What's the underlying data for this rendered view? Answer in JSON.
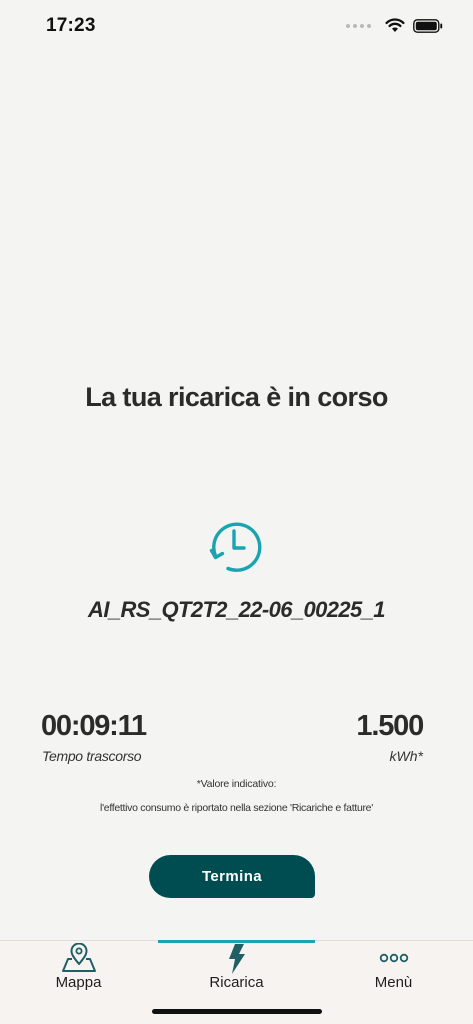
{
  "status_bar": {
    "time": "17:23"
  },
  "main": {
    "title": "La tua ricarica è in corso",
    "session_id": "AI_RS_QT2T2_22-06_00225_1",
    "elapsed": {
      "value": "00:09:11",
      "label": "Tempo trascorso"
    },
    "energy": {
      "value": "1.500",
      "unit": "kWh*"
    },
    "note_line1": "*Valore indicativo:",
    "note_line2": "l'effettivo consumo è riportato nella sezione 'Ricariche e fatture'",
    "end_button": "Termina"
  },
  "tab_bar": {
    "tabs": [
      {
        "label": "Mappa",
        "icon": "map-pin-icon",
        "active": false
      },
      {
        "label": "Ricarica",
        "icon": "lightning-bolt-icon",
        "active": true
      },
      {
        "label": "Menù",
        "icon": "more-dots-icon",
        "active": false
      }
    ]
  },
  "colors": {
    "accent": "#1aa3b0",
    "primary_button": "#004d51",
    "background": "#f4f5f3"
  }
}
